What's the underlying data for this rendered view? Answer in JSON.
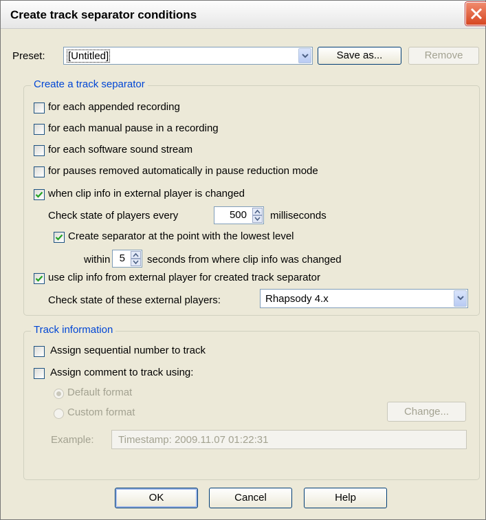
{
  "window": {
    "title": "Create track separator conditions"
  },
  "preset": {
    "label": "Preset:",
    "value": "[Untitled]",
    "save_as_label": "Save as...",
    "remove_label": "Remove"
  },
  "separator_group": {
    "legend": "Create a track separator",
    "options": {
      "appended": {
        "label": "for each appended recording",
        "checked": false
      },
      "manual_pause": {
        "label": "for each manual pause in a recording",
        "checked": false
      },
      "software_stream": {
        "label": "for each software sound stream",
        "checked": false
      },
      "pauses_removed": {
        "label": "for pauses removed automatically in pause reduction mode",
        "checked": false
      },
      "clip_info_changed": {
        "label": "when clip info in external player is changed",
        "checked": true
      },
      "use_clip_info": {
        "label": "use clip info from external player for created track separator",
        "checked": true
      }
    },
    "check_players": {
      "prefix": "Check state of players every",
      "value": "500",
      "suffix": "milliseconds"
    },
    "lowest_level": {
      "label": "Create separator at the point with the lowest level",
      "checked": true
    },
    "within": {
      "prefix": "within",
      "value": "5",
      "suffix": "seconds from where clip info was changed"
    },
    "external_players": {
      "label": "Check state of these external players:",
      "value": "Rhapsody 4.x"
    }
  },
  "track_group": {
    "legend": "Track information",
    "sequential": {
      "label": "Assign sequential number to track",
      "checked": false
    },
    "comment": {
      "label": "Assign comment to track using:",
      "checked": false
    },
    "default_format": {
      "label": "Default format",
      "selected": true
    },
    "custom_format": {
      "label": "Custom format",
      "selected": false
    },
    "change_label": "Change...",
    "example_label": "Example:",
    "example_value": "Timestamp: 2009.11.07 01:22:31"
  },
  "footer": {
    "ok_label": "OK",
    "cancel_label": "Cancel",
    "help_label": "Help"
  },
  "colors": {
    "dialog_bg": "#ece9d8",
    "legend_blue": "#0046d5",
    "close_red": "#d64722"
  }
}
